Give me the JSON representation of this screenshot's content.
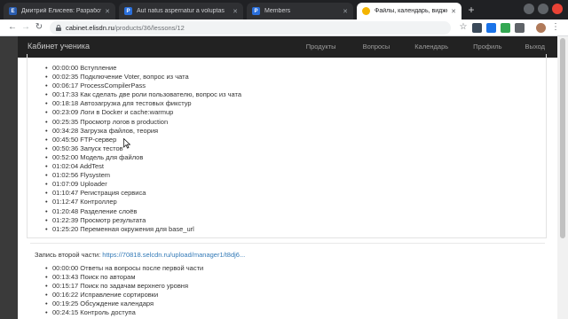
{
  "browser": {
    "tabs": [
      {
        "title": "Дмитрий Елисеев: Разработка",
        "fav_text": "E",
        "fav_color": "#2a5db0",
        "active": false
      },
      {
        "title": "Aut natus aspernatur a voluptas",
        "fav_text": "P",
        "fav_color": "#2a6fdb",
        "active": false
      },
      {
        "title": "Members",
        "fav_text": "P",
        "fav_color": "#2a6fdb",
        "active": false
      },
      {
        "title": "Файлы, календарь, виджеты, пр",
        "fav_text": "",
        "fav_color": "#f4b400",
        "active": true
      }
    ],
    "new_tab": "+",
    "address": {
      "host": "cabinet.elisdn.ru",
      "path": "/products/36/lessons/12"
    }
  },
  "site": {
    "brand": "Кабинет ученика",
    "menu": [
      "Продукты",
      "Вопросы",
      "Календарь",
      "Профиль",
      "Выход"
    ]
  },
  "part1": {
    "items": [
      "00:00:00 Вступление",
      "00:02:35 Подключение Voter, вопрос из чата",
      "00:06:17 ProcessCompilerPass",
      "00:17:33 Как сделать две роли пользователю, вопрос из чата",
      "00:18:18 Автозагрузка для тестовых фикстур",
      "00:23:09 Логи в Docker и cache:warmup",
      "00:25:35 Просмотр логов в production",
      "00:34:28 Загрузка файлов, теория",
      "00:45:50 FTP-сервер",
      "00:50:36 Запуск тестов",
      "00:52:00 Модель для файлов",
      "01:02:04 AddTest",
      "01:02:56 Flysystem",
      "01:07:09 Uploader",
      "01:10:47 Регистрация сервиса",
      "01:12:47 Контроллер",
      "01:20:48 Разделение слоёв",
      "01:22:39 Просмотр результата",
      "01:25:20 Переменная окружения для base_url"
    ]
  },
  "part2": {
    "label": "Запись второй части:",
    "link": "https://70818.selcdn.ru/upload/manager1/t8dj6...",
    "items": [
      "00:00:00 Ответы на вопросы после первой части",
      "00:13:43 Поиск по авторам",
      "00:15:17 Поиск по задачам верхнего уровня",
      "00:16:22 Исправление сортировки",
      "00:19:25 Обсуждение календаря",
      "00:24:15 Контроль доступа"
    ]
  },
  "colors": {
    "header_bg": "#222222",
    "link": "#337ab7",
    "menu_text": "#9d9d9d"
  },
  "icons": [
    "back-icon",
    "forward-icon",
    "reload-icon",
    "lock-icon",
    "star-icon"
  ]
}
